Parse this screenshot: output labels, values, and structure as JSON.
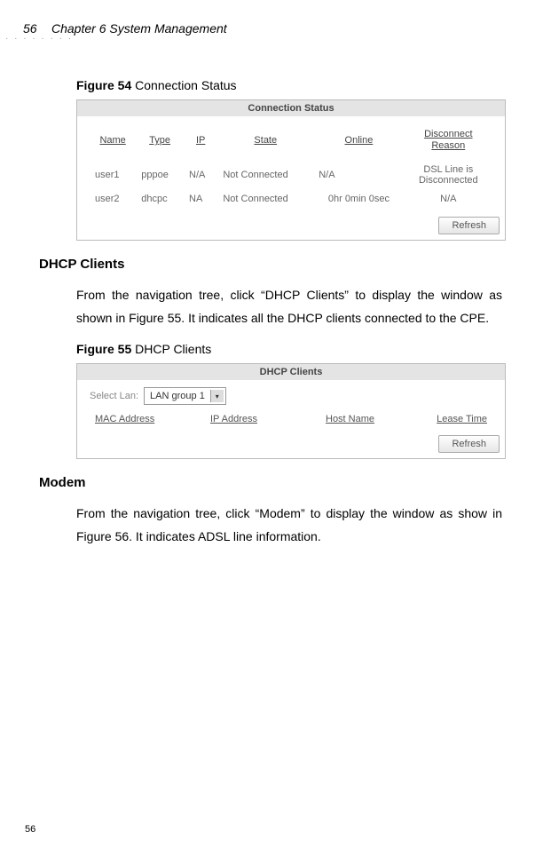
{
  "header": {
    "page_number_top": "56",
    "chapter": "Chapter 6 System Management"
  },
  "figure54": {
    "label_prefix": "Figure 54",
    "label_rest": " Connection Status",
    "panel_title": "Connection Status",
    "columns": {
      "name": "Name",
      "type": "Type",
      "ip": "IP",
      "state": "State",
      "online": "Online",
      "disconnect_line1": "Disconnect",
      "disconnect_line2": "Reason"
    },
    "rows": [
      {
        "name": "user1",
        "type": "pppoe",
        "ip": "N/A",
        "state": "Not Connected",
        "online": "N/A",
        "reason_line1": "DSL Line is",
        "reason_line2": "Disconnected"
      },
      {
        "name": "user2",
        "type": "dhcpc",
        "ip": "NA",
        "state": "Not Connected",
        "online": "0hr 0min 0sec",
        "reason_line1": "N/A",
        "reason_line2": ""
      }
    ],
    "refresh": "Refresh"
  },
  "section_dhcp": {
    "heading": "DHCP Clients",
    "para": "From the navigation tree, click “DHCP Clients” to display the window as shown in Figure 55. It indicates all the DHCP clients connected to the CPE."
  },
  "figure55": {
    "label_prefix": "Figure 55",
    "label_rest": " DHCP Clients",
    "panel_title": "DHCP Clients",
    "select_label": "Select Lan:",
    "select_value": "LAN group 1",
    "columns": {
      "mac": "MAC Address",
      "ip": "IP Address",
      "host": "Host Name",
      "lease": "Lease Time"
    },
    "refresh": "Refresh"
  },
  "section_modem": {
    "heading": "Modem",
    "para": "From the navigation tree, click “Modem” to display the window as show in Figure 56. It indicates ADSL line information."
  },
  "footer": {
    "page_number_bottom": "56"
  }
}
